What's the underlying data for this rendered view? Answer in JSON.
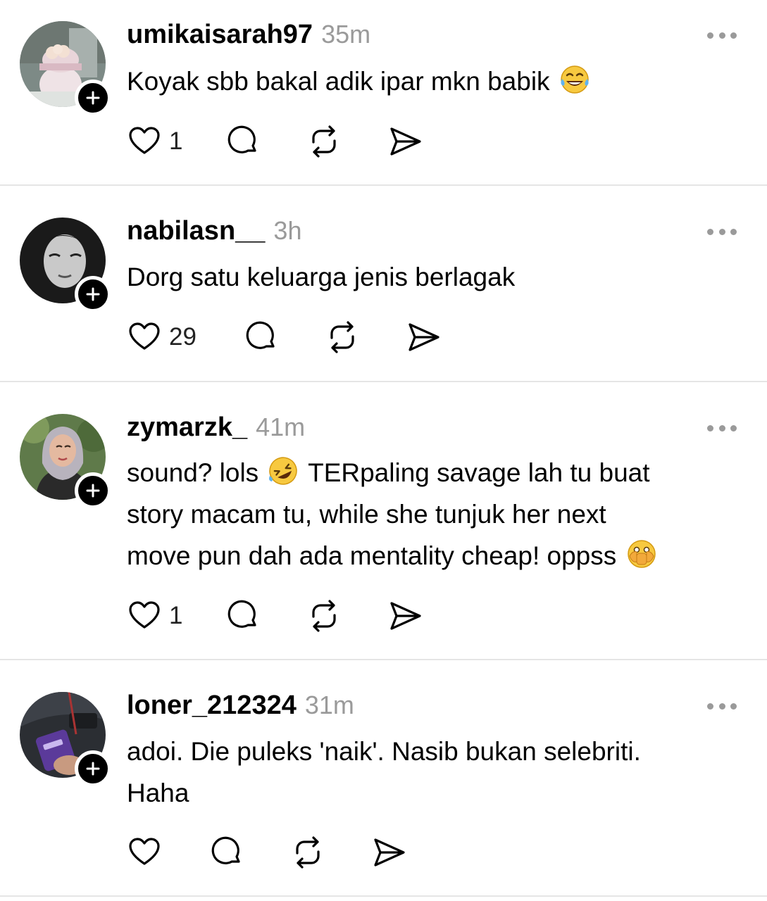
{
  "posts": [
    {
      "username": "umikaisarah97",
      "time": "35m",
      "text": "Koyak sbb bakal adik ipar mkn babik",
      "emoji": "tears-of-joy",
      "likes": "1",
      "avatar": "pink-figurine-avatar"
    },
    {
      "username": "nabilasn__",
      "time": "3h",
      "text": "Dorg satu keluarga jenis berlagak",
      "likes": "29",
      "avatar": "bw-portrait-avatar"
    },
    {
      "username": "zymarzk_",
      "time": "41m",
      "text_line1_a": "sound? lols",
      "text_line1_b": "TERpaling savage lah tu buat",
      "text_line2": "story macam tu, while she tunjuk her next",
      "text_line3": "move pun dah ada mentality cheap! oppss",
      "emojis": [
        "rolling-on-floor-laughing",
        "face-with-open-eyes-and-hand-over-mouth"
      ],
      "likes": "1",
      "avatar": "hijab-portrait-avatar"
    },
    {
      "username": "loner_212324",
      "time": "31m",
      "text_line1": "adoi. Die puleks 'naik'. Nasib bukan selebriti.",
      "text_line2": "Haha",
      "likes": "",
      "avatar": "car-interior-card-avatar"
    }
  ],
  "colors": {
    "text": "#000000",
    "muted": "#9a9a9a",
    "divider": "#e5e5e5",
    "badge": "#000000"
  }
}
